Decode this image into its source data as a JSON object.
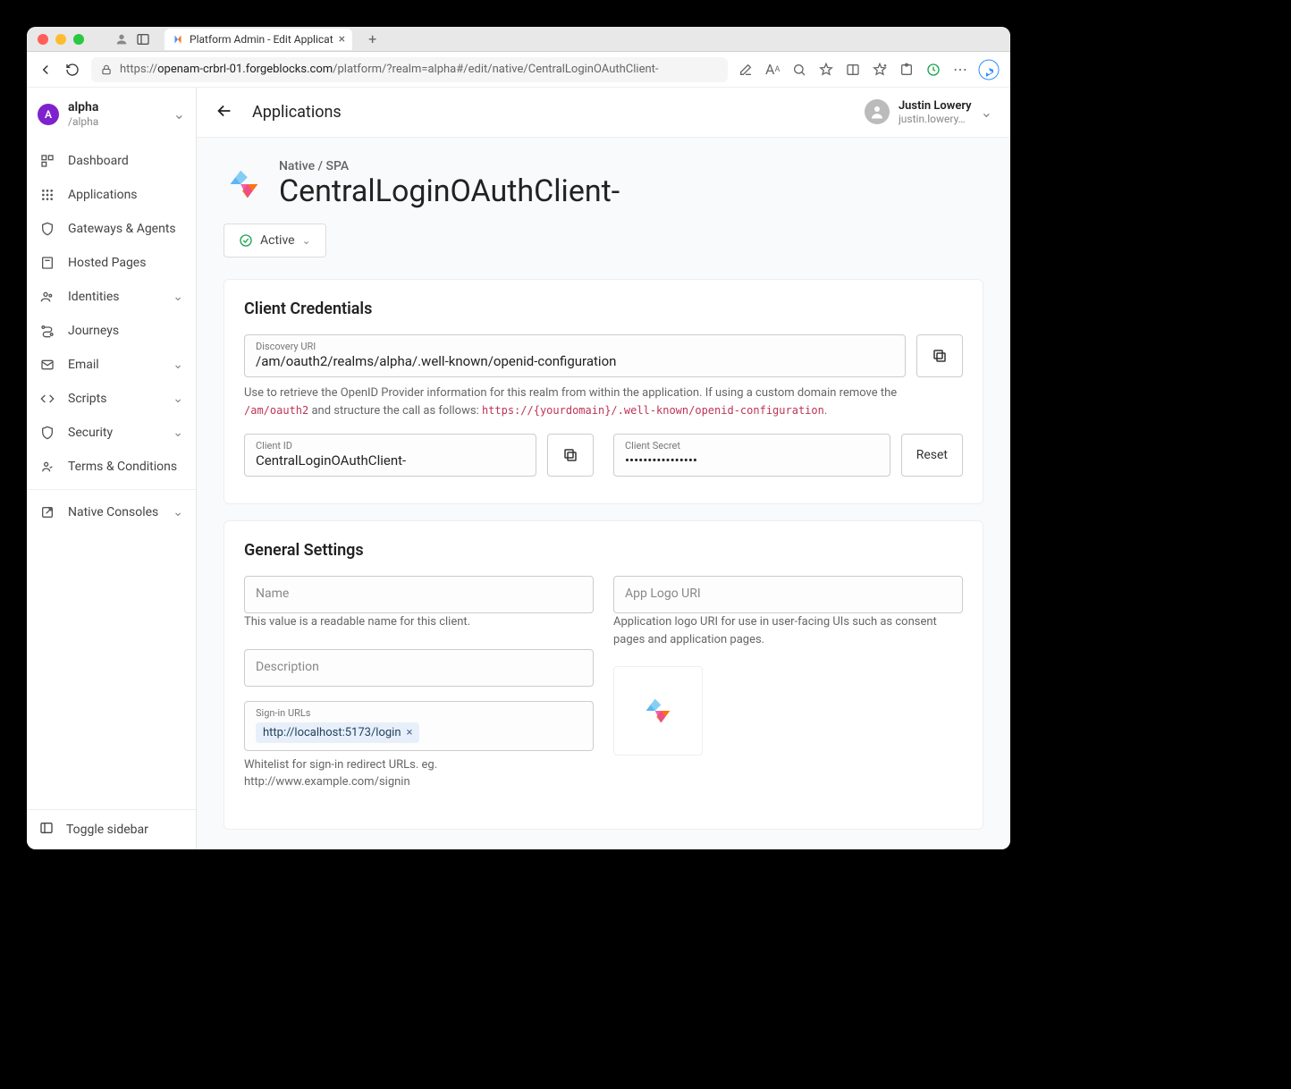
{
  "browser": {
    "tab_title": "Platform Admin - Edit Applicat",
    "url_display_prefix": "https://",
    "url_display_host": "openam-crbrl-01.forgeblocks.com",
    "url_display_path": "/platform/?realm=alpha#/edit/native/CentralLoginOAuthClient-"
  },
  "sidebar": {
    "realm_badge": "A",
    "realm_name": "alpha",
    "realm_path": "/alpha",
    "items": [
      {
        "icon": "dashboard",
        "label": "Dashboard",
        "chev": false
      },
      {
        "icon": "apps",
        "label": "Applications",
        "chev": false
      },
      {
        "icon": "shield",
        "label": "Gateways & Agents",
        "chev": false
      },
      {
        "icon": "page",
        "label": "Hosted Pages",
        "chev": false
      },
      {
        "icon": "people",
        "label": "Identities",
        "chev": true
      },
      {
        "icon": "route",
        "label": "Journeys",
        "chev": false
      },
      {
        "icon": "mail",
        "label": "Email",
        "chev": true
      },
      {
        "icon": "code",
        "label": "Scripts",
        "chev": true
      },
      {
        "icon": "lock",
        "label": "Security",
        "chev": true
      },
      {
        "icon": "handshake",
        "label": "Terms & Conditions",
        "chev": false
      }
    ],
    "native_consoles": "Native Consoles",
    "toggle_label": "Toggle sidebar"
  },
  "topbar": {
    "page_title": "Applications",
    "user_name": "Justin Lowery",
    "user_email": "justin.lowery…"
  },
  "app_header": {
    "type_label": "Native / SPA",
    "app_name": "CentralLoginOAuthClient-",
    "status_label": "Active"
  },
  "client_creds": {
    "heading": "Client Credentials",
    "discovery_label": "Discovery URI",
    "discovery_value": "/am/oauth2/realms/alpha/.well-known/openid-configuration",
    "discovery_help_pre": "Use to retrieve the OpenID Provider information for this realm from within the application. If using a custom domain remove the ",
    "discovery_help_code1": "/am/oauth2",
    "discovery_help_mid": " and structure the call as follows: ",
    "discovery_help_code2": "https://{yourdomain}/.well-known/openid-configuration",
    "client_id_label": "Client ID",
    "client_id_value": "CentralLoginOAuthClient-",
    "client_secret_label": "Client Secret",
    "client_secret_value": "••••••••••••••••",
    "reset_label": "Reset"
  },
  "general": {
    "heading": "General Settings",
    "name_label": "Name",
    "name_help": "This value is a readable name for this client.",
    "logo_label": "App Logo URI",
    "logo_help": "Application logo URI for use in user-facing UIs such as consent pages and application pages.",
    "desc_label": "Description",
    "signin_label": "Sign-in URLs",
    "signin_chip": "http://localhost:5173/login",
    "signin_help": "Whitelist for sign-in redirect URLs. eg. http://www.example.com/signin"
  }
}
